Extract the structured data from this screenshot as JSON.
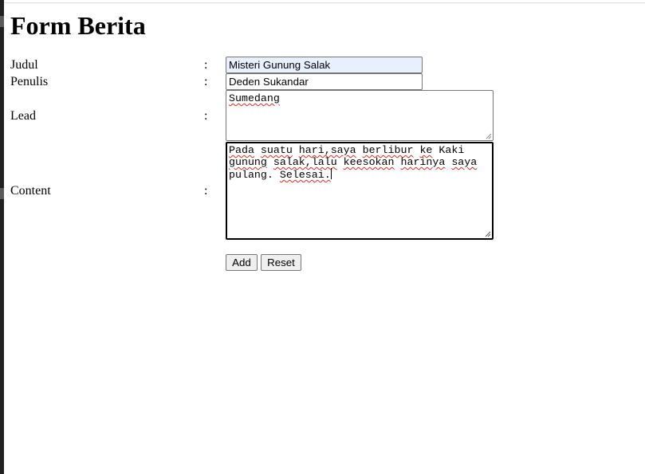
{
  "page": {
    "title": "Form Berita"
  },
  "form": {
    "colon": ":",
    "judul": {
      "label": "Judul",
      "value": "Misteri Gunung Salak"
    },
    "penulis": {
      "label": "Penulis",
      "value": "Deden Sukandar"
    },
    "lead": {
      "label": "Lead",
      "value": "Sumedang"
    },
    "content": {
      "label": "Content",
      "words": [
        "Pada",
        "suatu",
        "hari,saya",
        "berlibur",
        "ke",
        "Kaki",
        "gunung",
        "salak,lalu",
        "keesokan",
        "harinya",
        "saya",
        "pulang.",
        "Selesai."
      ]
    },
    "buttons": {
      "add": "Add",
      "reset": "Reset"
    }
  }
}
